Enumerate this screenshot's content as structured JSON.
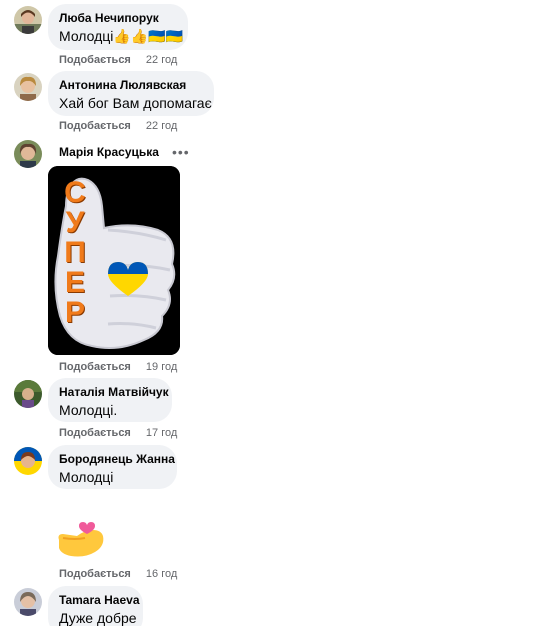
{
  "comments": [
    {
      "author": "Люба Нечипорук",
      "text": "Молодці👍👍🇺🇦🇺🇦",
      "like_label": "Подобається",
      "time": "22 год"
    },
    {
      "author": "Антонина Люлявская",
      "text": "Хай бог Вам допомагає",
      "like_label": "Подобається",
      "time": "22 год"
    },
    {
      "author": "Марія Красуцька",
      "sticker_text": "СУПЕР",
      "more_label": "•••",
      "like_label": "Подобається",
      "time": "19 год"
    },
    {
      "author": "Наталія Матвійчук",
      "text": "Молодці.",
      "like_label": "Подобається",
      "time": "17 год"
    },
    {
      "author": "Бородянець Жанна",
      "text": "Молодці",
      "like_label": "Подобається",
      "time": "16 год"
    },
    {
      "author": "Tamara Haeva",
      "text": "Дуже добре"
    }
  ],
  "colors": {
    "bubble": "#f0f2f5",
    "meta": "#65676b",
    "ukraine_blue": "#0057b7",
    "ukraine_yellow": "#ffd700",
    "sticker_letters": "#f07a1a"
  },
  "icons": {
    "more": "more-options-icon",
    "sticker": "thumbs-up-super-sticker",
    "emoji": "hand-with-heart-emoji"
  }
}
